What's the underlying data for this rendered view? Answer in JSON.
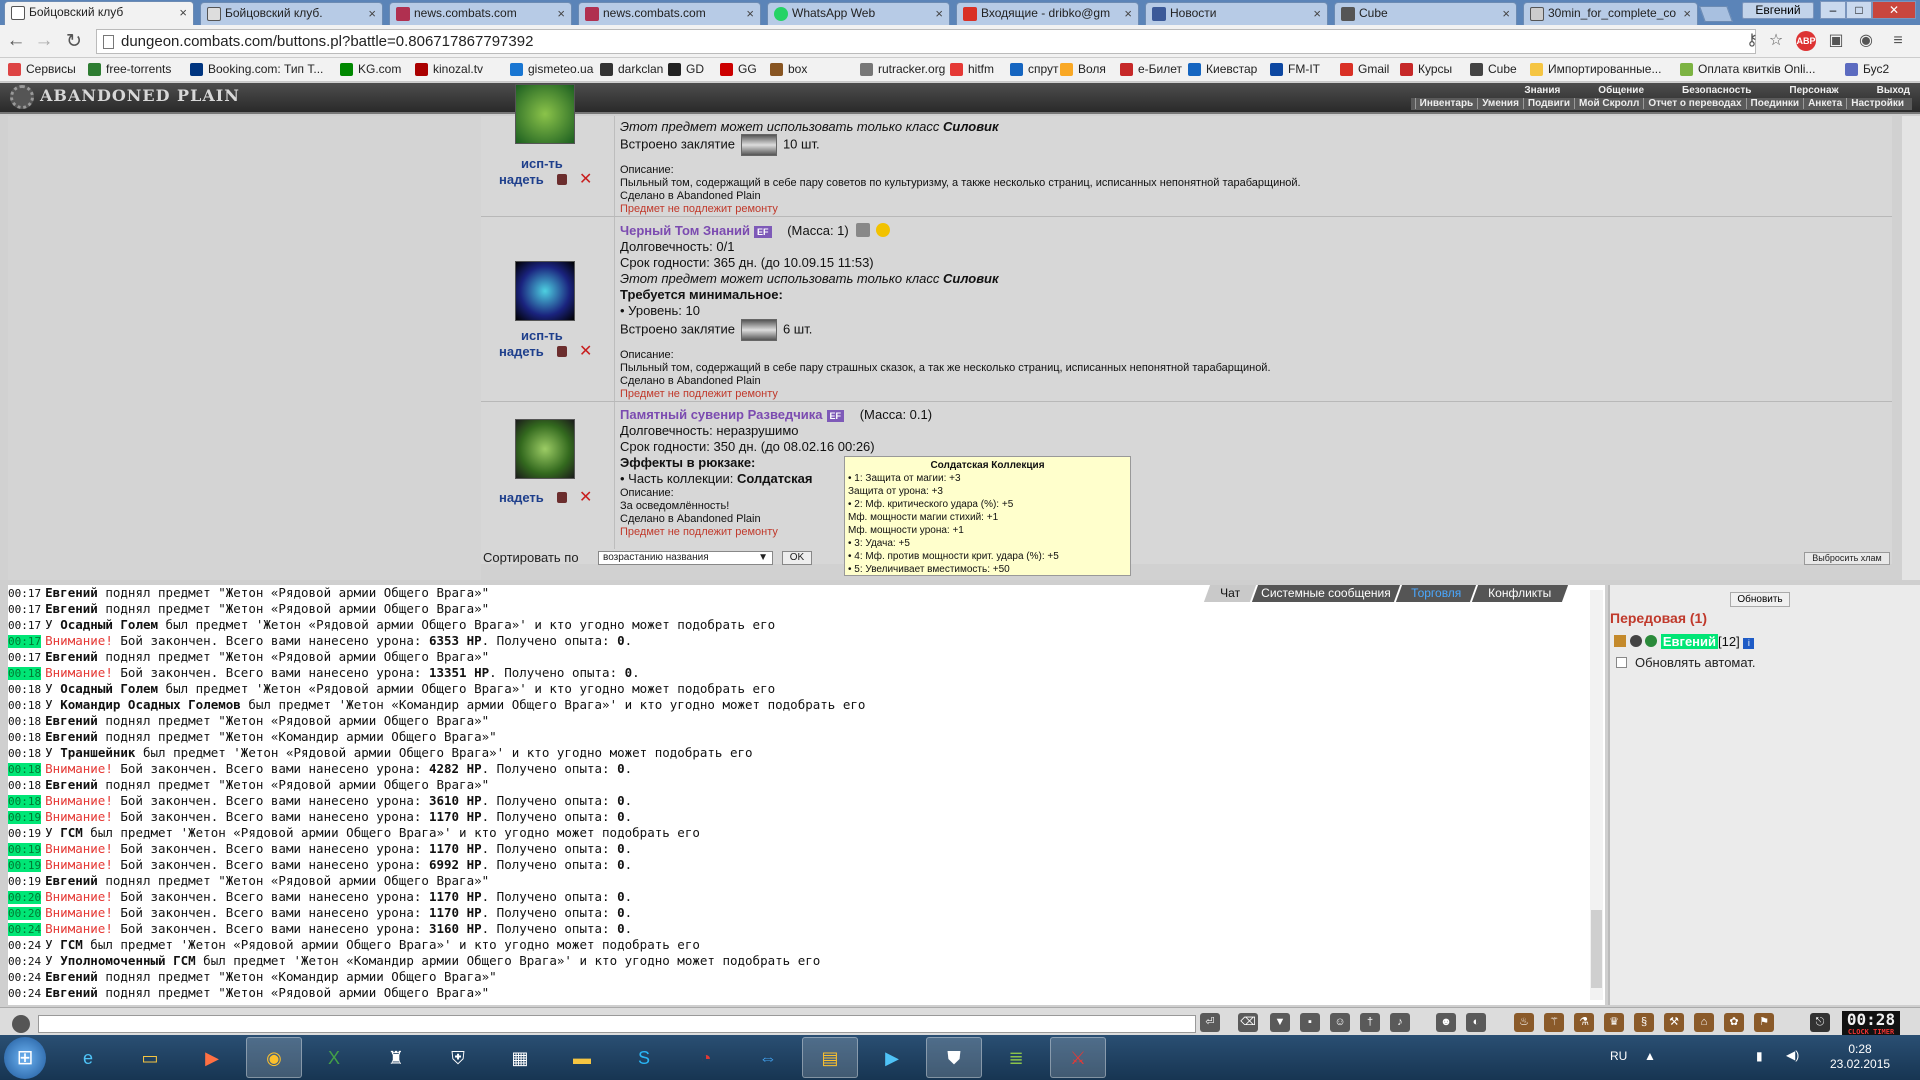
{
  "browser": {
    "tabs": [
      {
        "label": "Бойцовский клуб",
        "color": "#444444",
        "active": true
      },
      {
        "label": "Бойцовский клуб.",
        "color": "#444444"
      },
      {
        "label": "news.combats.com",
        "color": "#b03050"
      },
      {
        "label": "news.combats.com",
        "color": "#b03050"
      },
      {
        "label": "WhatsApp Web",
        "color": "#25d366"
      },
      {
        "label": "Входящие - dribko@gm",
        "color": "#d93025"
      },
      {
        "label": "Новости",
        "color": "#3b5998"
      },
      {
        "label": "Cube",
        "color": "#555555"
      },
      {
        "label": "30min_for_complete_co",
        "color": "#666666"
      }
    ],
    "user": "Евгений",
    "url": "dungeon.combats.com/buttons.pl?battle=0.806717867797392",
    "bookmarks": [
      {
        "label": "Сервисы",
        "color": "#dd4444"
      },
      {
        "label": "free-torrents",
        "color": "#2e7d32"
      },
      {
        "label": "Booking.com: Тип Т...",
        "color": "#003580"
      },
      {
        "label": "KG.com",
        "color": "#008800"
      },
      {
        "label": "kinozal.tv",
        "color": "#aa0000"
      },
      {
        "label": "gismeteo.ua",
        "color": "#1976d2"
      },
      {
        "label": "darkclan",
        "color": "#333333"
      },
      {
        "label": "GD",
        "color": "#222222"
      },
      {
        "label": "GG",
        "color": "#cc0000"
      },
      {
        "label": "box",
        "color": "#885522"
      },
      {
        "label": "rutracker.org",
        "color": "#777777"
      },
      {
        "label": "hitfm",
        "color": "#e53935"
      },
      {
        "label": "спрут",
        "color": "#1565c0"
      },
      {
        "label": "Воля",
        "color": "#f9a825"
      },
      {
        "label": "e-Билет",
        "color": "#c62828"
      },
      {
        "label": "Киевстар",
        "color": "#1565c0"
      },
      {
        "label": "FM-IT",
        "color": "#0d47a1"
      },
      {
        "label": "Gmail",
        "color": "#d93025"
      },
      {
        "label": "Курсы",
        "color": "#c62828"
      },
      {
        "label": "Cube",
        "color": "#444444"
      },
      {
        "label": "Импортированные...",
        "color": "#f5c542"
      },
      {
        "label": "Оплата квитків Onli...",
        "color": "#7cb342"
      },
      {
        "label": "Бус2",
        "color": "#5c6bc0"
      }
    ]
  },
  "game": {
    "logo": "ABANDONED PLAIN",
    "top_menu": [
      "Знания",
      "Общение",
      "Безопасность",
      "Персонаж",
      "Выход"
    ],
    "sub_menu": [
      "Инвентарь",
      "Умения",
      "Подвиги",
      "Мой Скролл",
      "Отчет о переводах",
      "Поединки",
      "Анкета",
      "Настройки"
    ],
    "actions": {
      "use": "исп-ть",
      "wear": "надеть"
    },
    "items": [
      {
        "class_line_prefix": "Этот предмет может использовать только класс ",
        "class_name": "Силовик",
        "spell_prefix": "Встроено заклятие",
        "spell_count": "10 шт.",
        "desc_label": "Описание:",
        "desc": "Пыльный том, содержащий в себе пару советов по культуризму, а также несколько страниц, исписанных непонятной тарабарщиной.",
        "made": "Сделано в Abandoned Plain",
        "repair": "Предмет не подлежит ремонту"
      },
      {
        "name": "Черный Том Знаний",
        "badge": "EF",
        "mass": "(Масса: 1)",
        "durability": "Долговечность: 0/1",
        "expiry": "Срок годности: 365 дн. (до 10.09.15 11:53)",
        "class_line_prefix": "Этот предмет может использовать только класс ",
        "class_name": "Силовик",
        "req": "Требуется минимальное:",
        "level": "• Уровень: 10",
        "spell_prefix": "Встроено заклятие",
        "spell_count": "6 шт.",
        "desc_label": "Описание:",
        "desc": "Пыльный том, содержащий в себе пару страшных сказок, а так же несколько страниц, исписанных непонятной тарабарщиной.",
        "made": "Сделано в Abandoned Plain",
        "repair": "Предмет не подлежит ремонту"
      },
      {
        "name": "Памятный сувенир Разведчика",
        "badge": "EF",
        "mass": "(Масса: 0.1)",
        "durability": "Долговечность: неразрушимо",
        "expiry": "Срок годности: 350 дн. (до 08.02.16 00:26)",
        "effects": "Эффекты в рюкзаке:",
        "collection_prefix": "• Часть коллекции: ",
        "collection_name": "Солдатская",
        "desc_label": "Описание:",
        "desc": "За осведомлённость!",
        "made": "Сделано в Abandoned Plain",
        "repair": "Предмет не подлежит ремонту"
      }
    ],
    "sort_label": "Сортировать по",
    "sort_value": "возрастанию названия",
    "sort_ok": "OK",
    "junk_button": "Выбросить хлам",
    "tooltip": {
      "title": "Солдатская Коллекция",
      "lines": [
        "• 1: Защита от магии: +3",
        "Защита от урона: +3",
        "• 2: Мф. критического удара (%): +5",
        "Мф. мощности магии стихий: +1",
        "Мф. мощности урона: +1",
        "• 3: Удача: +5",
        "• 4: Мф. против мощности крит. удара (%): +5",
        "• 5: Увеличивает вместимость: +50"
      ]
    },
    "chat_tabs": [
      "Чат",
      "Системные сообщения",
      "Торговля",
      "Конфликты"
    ],
    "chat": [
      {
        "time": "00:17",
        "hl": false,
        "parts": [
          {
            "t": "Евгений",
            "b": true
          },
          {
            "t": " поднял предмет \"Жетон «Рядовой армии Общего Врага»\""
          }
        ]
      },
      {
        "time": "00:17",
        "hl": false,
        "parts": [
          {
            "t": "Евгений",
            "b": true
          },
          {
            "t": " поднял предмет \"Жетон «Рядовой армии Общего Врага»\""
          }
        ]
      },
      {
        "time": "00:17",
        "hl": false,
        "parts": [
          {
            "t": "У "
          },
          {
            "t": "Осадный Голем",
            "b": true
          },
          {
            "t": " был предмет 'Жетон «Рядовой армии Общего Врага»' и кто угодно может подобрать его"
          }
        ]
      },
      {
        "time": "00:17",
        "hl": true,
        "parts": [
          {
            "t": "Внимание!",
            "w": true
          },
          {
            "t": " Бой закончен. Всего вами нанесено урона: "
          },
          {
            "t": "6353 HP",
            "b": true
          },
          {
            "t": ". Получено опыта: "
          },
          {
            "t": "0",
            "b": true
          },
          {
            "t": "."
          }
        ]
      },
      {
        "time": "00:17",
        "hl": false,
        "parts": [
          {
            "t": "Евгений",
            "b": true
          },
          {
            "t": " поднял предмет \"Жетон «Рядовой армии Общего Врага»\""
          }
        ]
      },
      {
        "time": "00:18",
        "hl": true,
        "parts": [
          {
            "t": "Внимание!",
            "w": true
          },
          {
            "t": " Бой закончен. Всего вами нанесено урона: "
          },
          {
            "t": "13351 HP",
            "b": true
          },
          {
            "t": ". Получено опыта: "
          },
          {
            "t": "0",
            "b": true
          },
          {
            "t": "."
          }
        ]
      },
      {
        "time": "00:18",
        "hl": false,
        "parts": [
          {
            "t": "У "
          },
          {
            "t": "Осадный Голем",
            "b": true
          },
          {
            "t": " был предмет 'Жетон «Рядовой армии Общего Врага»' и кто угодно может подобрать его"
          }
        ]
      },
      {
        "time": "00:18",
        "hl": false,
        "parts": [
          {
            "t": "У "
          },
          {
            "t": "Командир Осадных Големов",
            "b": true
          },
          {
            "t": " был предмет 'Жетон «Командир армии Общего Врага»' и кто угодно может подобрать его"
          }
        ]
      },
      {
        "time": "00:18",
        "hl": false,
        "parts": [
          {
            "t": "Евгений",
            "b": true
          },
          {
            "t": " поднял предмет \"Жетон «Рядовой армии Общего Врага»\""
          }
        ]
      },
      {
        "time": "00:18",
        "hl": false,
        "parts": [
          {
            "t": "Евгений",
            "b": true
          },
          {
            "t": " поднял предмет \"Жетон «Командир армии Общего Врага»\""
          }
        ]
      },
      {
        "time": "00:18",
        "hl": false,
        "parts": [
          {
            "t": "У "
          },
          {
            "t": "Траншейник",
            "b": true
          },
          {
            "t": " был предмет 'Жетон «Рядовой армии Общего Врага»' и кто угодно может подобрать его"
          }
        ]
      },
      {
        "time": "00:18",
        "hl": true,
        "parts": [
          {
            "t": "Внимание!",
            "w": true
          },
          {
            "t": " Бой закончен. Всего вами нанесено урона: "
          },
          {
            "t": "4282 HP",
            "b": true
          },
          {
            "t": ". Получено опыта: "
          },
          {
            "t": "0",
            "b": true
          },
          {
            "t": "."
          }
        ]
      },
      {
        "time": "00:18",
        "hl": false,
        "parts": [
          {
            "t": "Евгений",
            "b": true
          },
          {
            "t": " поднял предмет \"Жетон «Рядовой армии Общего Врага»\""
          }
        ]
      },
      {
        "time": "00:18",
        "hl": true,
        "parts": [
          {
            "t": "Внимание!",
            "w": true
          },
          {
            "t": " Бой закончен. Всего вами нанесено урона: "
          },
          {
            "t": "3610 HP",
            "b": true
          },
          {
            "t": ". Получено опыта: "
          },
          {
            "t": "0",
            "b": true
          },
          {
            "t": "."
          }
        ]
      },
      {
        "time": "00:19",
        "hl": true,
        "parts": [
          {
            "t": "Внимание!",
            "w": true
          },
          {
            "t": " Бой закончен. Всего вами нанесено урона: "
          },
          {
            "t": "1170 HP",
            "b": true
          },
          {
            "t": ". Получено опыта: "
          },
          {
            "t": "0",
            "b": true
          },
          {
            "t": "."
          }
        ]
      },
      {
        "time": "00:19",
        "hl": false,
        "parts": [
          {
            "t": "У "
          },
          {
            "t": "ГСМ",
            "b": true
          },
          {
            "t": " был предмет 'Жетон «Рядовой армии Общего Врага»' и кто угодно может подобрать его"
          }
        ]
      },
      {
        "time": "00:19",
        "hl": true,
        "parts": [
          {
            "t": "Внимание!",
            "w": true
          },
          {
            "t": " Бой закончен. Всего вами нанесено урона: "
          },
          {
            "t": "1170 HP",
            "b": true
          },
          {
            "t": ". Получено опыта: "
          },
          {
            "t": "0",
            "b": true
          },
          {
            "t": "."
          }
        ]
      },
      {
        "time": "00:19",
        "hl": true,
        "parts": [
          {
            "t": "Внимание!",
            "w": true
          },
          {
            "t": " Бой закончен. Всего вами нанесено урона: "
          },
          {
            "t": "6992 HP",
            "b": true
          },
          {
            "t": ". Получено опыта: "
          },
          {
            "t": "0",
            "b": true
          },
          {
            "t": "."
          }
        ]
      },
      {
        "time": "00:19",
        "hl": false,
        "parts": [
          {
            "t": "Евгений",
            "b": true
          },
          {
            "t": " поднял предмет \"Жетон «Рядовой армии Общего Врага»\""
          }
        ]
      },
      {
        "time": "00:20",
        "hl": true,
        "parts": [
          {
            "t": "Внимание!",
            "w": true
          },
          {
            "t": " Бой закончен. Всего вами нанесено урона: "
          },
          {
            "t": "1170 HP",
            "b": true
          },
          {
            "t": ". Получено опыта: "
          },
          {
            "t": "0",
            "b": true
          },
          {
            "t": "."
          }
        ]
      },
      {
        "time": "00:20",
        "hl": true,
        "parts": [
          {
            "t": "Внимание!",
            "w": true
          },
          {
            "t": " Бой закончен. Всего вами нанесено урона: "
          },
          {
            "t": "1170 HP",
            "b": true
          },
          {
            "t": ". Получено опыта: "
          },
          {
            "t": "0",
            "b": true
          },
          {
            "t": "."
          }
        ]
      },
      {
        "time": "00:24",
        "hl": true,
        "parts": [
          {
            "t": "Внимание!",
            "w": true
          },
          {
            "t": " Бой закончен. Всего вами нанесено урона: "
          },
          {
            "t": "3160 HP",
            "b": true
          },
          {
            "t": ". Получено опыта: "
          },
          {
            "t": "0",
            "b": true
          },
          {
            "t": "."
          }
        ]
      },
      {
        "time": "00:24",
        "hl": false,
        "parts": [
          {
            "t": "У "
          },
          {
            "t": "ГСМ",
            "b": true
          },
          {
            "t": " был предмет 'Жетон «Рядовой армии Общего Врага»' и кто угодно может подобрать его"
          }
        ]
      },
      {
        "time": "00:24",
        "hl": false,
        "parts": [
          {
            "t": "У "
          },
          {
            "t": "Уполномоченный ГСМ",
            "b": true
          },
          {
            "t": " был предмет 'Жетон «Командир армии Общего Врага»' и кто угодно может подобрать его"
          }
        ]
      },
      {
        "time": "00:24",
        "hl": false,
        "parts": [
          {
            "t": "Евгений",
            "b": true
          },
          {
            "t": " поднял предмет \"Жетон «Командир армии Общего Врага»\""
          }
        ]
      },
      {
        "time": "00:24",
        "hl": false,
        "parts": [
          {
            "t": "Евгений",
            "b": true
          },
          {
            "t": " поднял предмет \"Жетон «Рядовой армии Общего Врага»\""
          }
        ]
      }
    ],
    "right_panel": {
      "refresh": "Обновить",
      "location": "Передовая (1)",
      "player_name": "Евгений",
      "player_level": "[12]",
      "auto_refresh": "Обновлять автомат."
    },
    "game_clock": "00:28",
    "game_clock_sub": "CLOCK TIMER"
  },
  "taskbar": {
    "lang": "RU",
    "time": "0:28",
    "date": "23.02.2015"
  }
}
